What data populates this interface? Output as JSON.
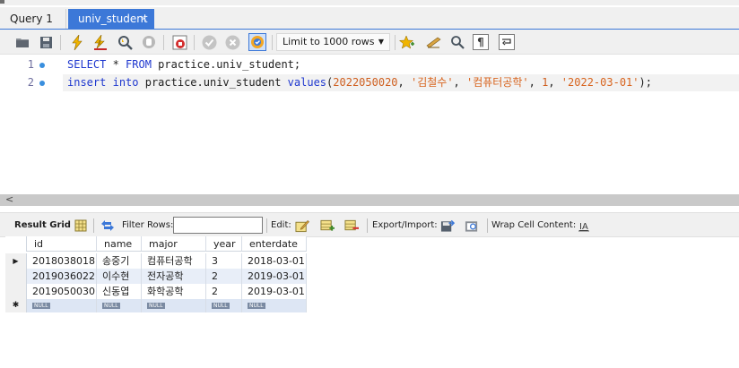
{
  "tabs": [
    {
      "label": "Query 1",
      "active": false
    },
    {
      "label": "univ_student",
      "active": true,
      "close": "×"
    }
  ],
  "toolbar": {
    "limit_rows": "Limit to 1000 rows"
  },
  "editor": {
    "lines": [
      {
        "number": "1",
        "text": "SELECT * FROM practice.univ_student;"
      },
      {
        "number": "2",
        "text": "insert into practice.univ_student values(2022050020, '김철수', '컴퓨터공학', 1, '2022-03-01');"
      }
    ]
  },
  "scrollbar": {
    "left_arrow": "<"
  },
  "result_toolbar": {
    "result_grid": "Result Grid",
    "filter_rows": "Filter Rows:",
    "filter_value": "",
    "edit": "Edit:",
    "export_import": "Export/Import:",
    "wrap_cell": "Wrap Cell Content:"
  },
  "grid": {
    "columns": [
      "id",
      "name",
      "major",
      "year",
      "enterdate"
    ],
    "rows": [
      [
        "2018038018",
        "송중기",
        "컴퓨터공학",
        "3",
        "2018-03-01"
      ],
      [
        "2019036022",
        "이수현",
        "전자공학",
        "2",
        "2019-03-01"
      ],
      [
        "2019050030",
        "신동엽",
        "화학공학",
        "2",
        "2019-03-01"
      ]
    ],
    "null_label": "NULL",
    "current_row_marker": "▶",
    "new_row_marker": "✱"
  },
  "colors": {
    "active_tab": "#3c78d8",
    "keyword": "#1f38cf",
    "string": "#d8641e",
    "row_alt": "#e8eef8"
  },
  "icons": [
    "open-folder-icon",
    "save-icon",
    "execute-lightning-icon",
    "execute-selection-icon",
    "explain-magnifier-icon",
    "stop-icon",
    "toggle-output-icon",
    "commit-icon",
    "rollback-icon",
    "autocommit-icon",
    "bookmark-star-icon",
    "beautify-brush-icon",
    "find-icon",
    "invisible-chars-icon",
    "wrap-lines-icon",
    "grid-icon",
    "refresh-icon",
    "edit-row-icon",
    "add-row-icon",
    "delete-row-icon",
    "export-icon",
    "import-icon",
    "wrap-cell-icon"
  ]
}
